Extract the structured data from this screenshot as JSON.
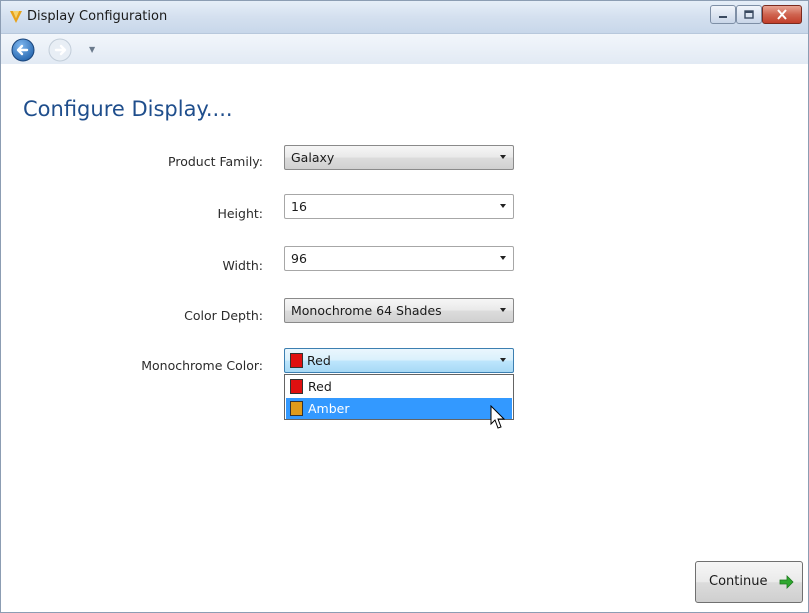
{
  "window": {
    "title": "Display Configuration"
  },
  "page": {
    "title": "Configure Display...."
  },
  "form": {
    "product_family": {
      "label": "Product Family:",
      "value": "Galaxy"
    },
    "height": {
      "label": "Height:",
      "value": "16"
    },
    "width": {
      "label": "Width:",
      "value": "96"
    },
    "color_depth": {
      "label": "Color Depth:",
      "value": "Monochrome 64 Shades"
    },
    "monochrome_color": {
      "label": "Monochrome Color:",
      "value": "Red",
      "value_swatch": "#e01010",
      "options": [
        {
          "label": "Red",
          "swatch": "#e01010",
          "highlighted": false
        },
        {
          "label": "Amber",
          "swatch": "#e09a1a",
          "highlighted": true
        }
      ]
    }
  },
  "footer": {
    "continue_label": "Continue"
  },
  "colors": {
    "title_blue": "#1f4e8c",
    "selection_blue": "#3399ff",
    "continue_arrow_green": "#2fa82f"
  },
  "icons": {
    "app": "app-logo-icon",
    "back": "back-arrow-icon",
    "forward": "forward-arrow-icon",
    "minimize": "minimize-icon",
    "maximize": "maximize-icon",
    "close": "close-icon",
    "continue": "arrow-right-icon"
  }
}
